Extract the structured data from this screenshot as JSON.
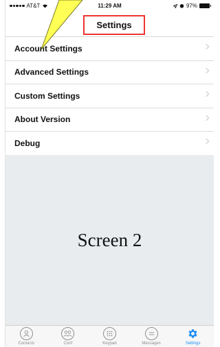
{
  "status_bar": {
    "carrier": "AT&T",
    "time": "11:29 AM",
    "battery": "97%"
  },
  "nav": {
    "title": "Settings"
  },
  "menu": {
    "items": [
      {
        "label": "Account Settings"
      },
      {
        "label": "Advanced Settings"
      },
      {
        "label": "Custom Settings"
      },
      {
        "label": "About Version"
      },
      {
        "label": "Debug"
      }
    ]
  },
  "content": {
    "label": "Screen 2"
  },
  "tab_bar": {
    "tabs": [
      {
        "label": "Contacts",
        "icon": "person-icon"
      },
      {
        "label": "Conf",
        "icon": "group-icon"
      },
      {
        "label": "Keypad",
        "icon": "keypad-icon"
      },
      {
        "label": "Messages",
        "icon": "chat-bubble-icon"
      },
      {
        "label": "Settings",
        "icon": "gear-icon"
      }
    ],
    "active": "Settings",
    "active_color": "#1a8ef7"
  },
  "colors": {
    "callout_fill": "#ffff55",
    "highlight_border": "#e33",
    "content_bg": "#e8ecef"
  }
}
